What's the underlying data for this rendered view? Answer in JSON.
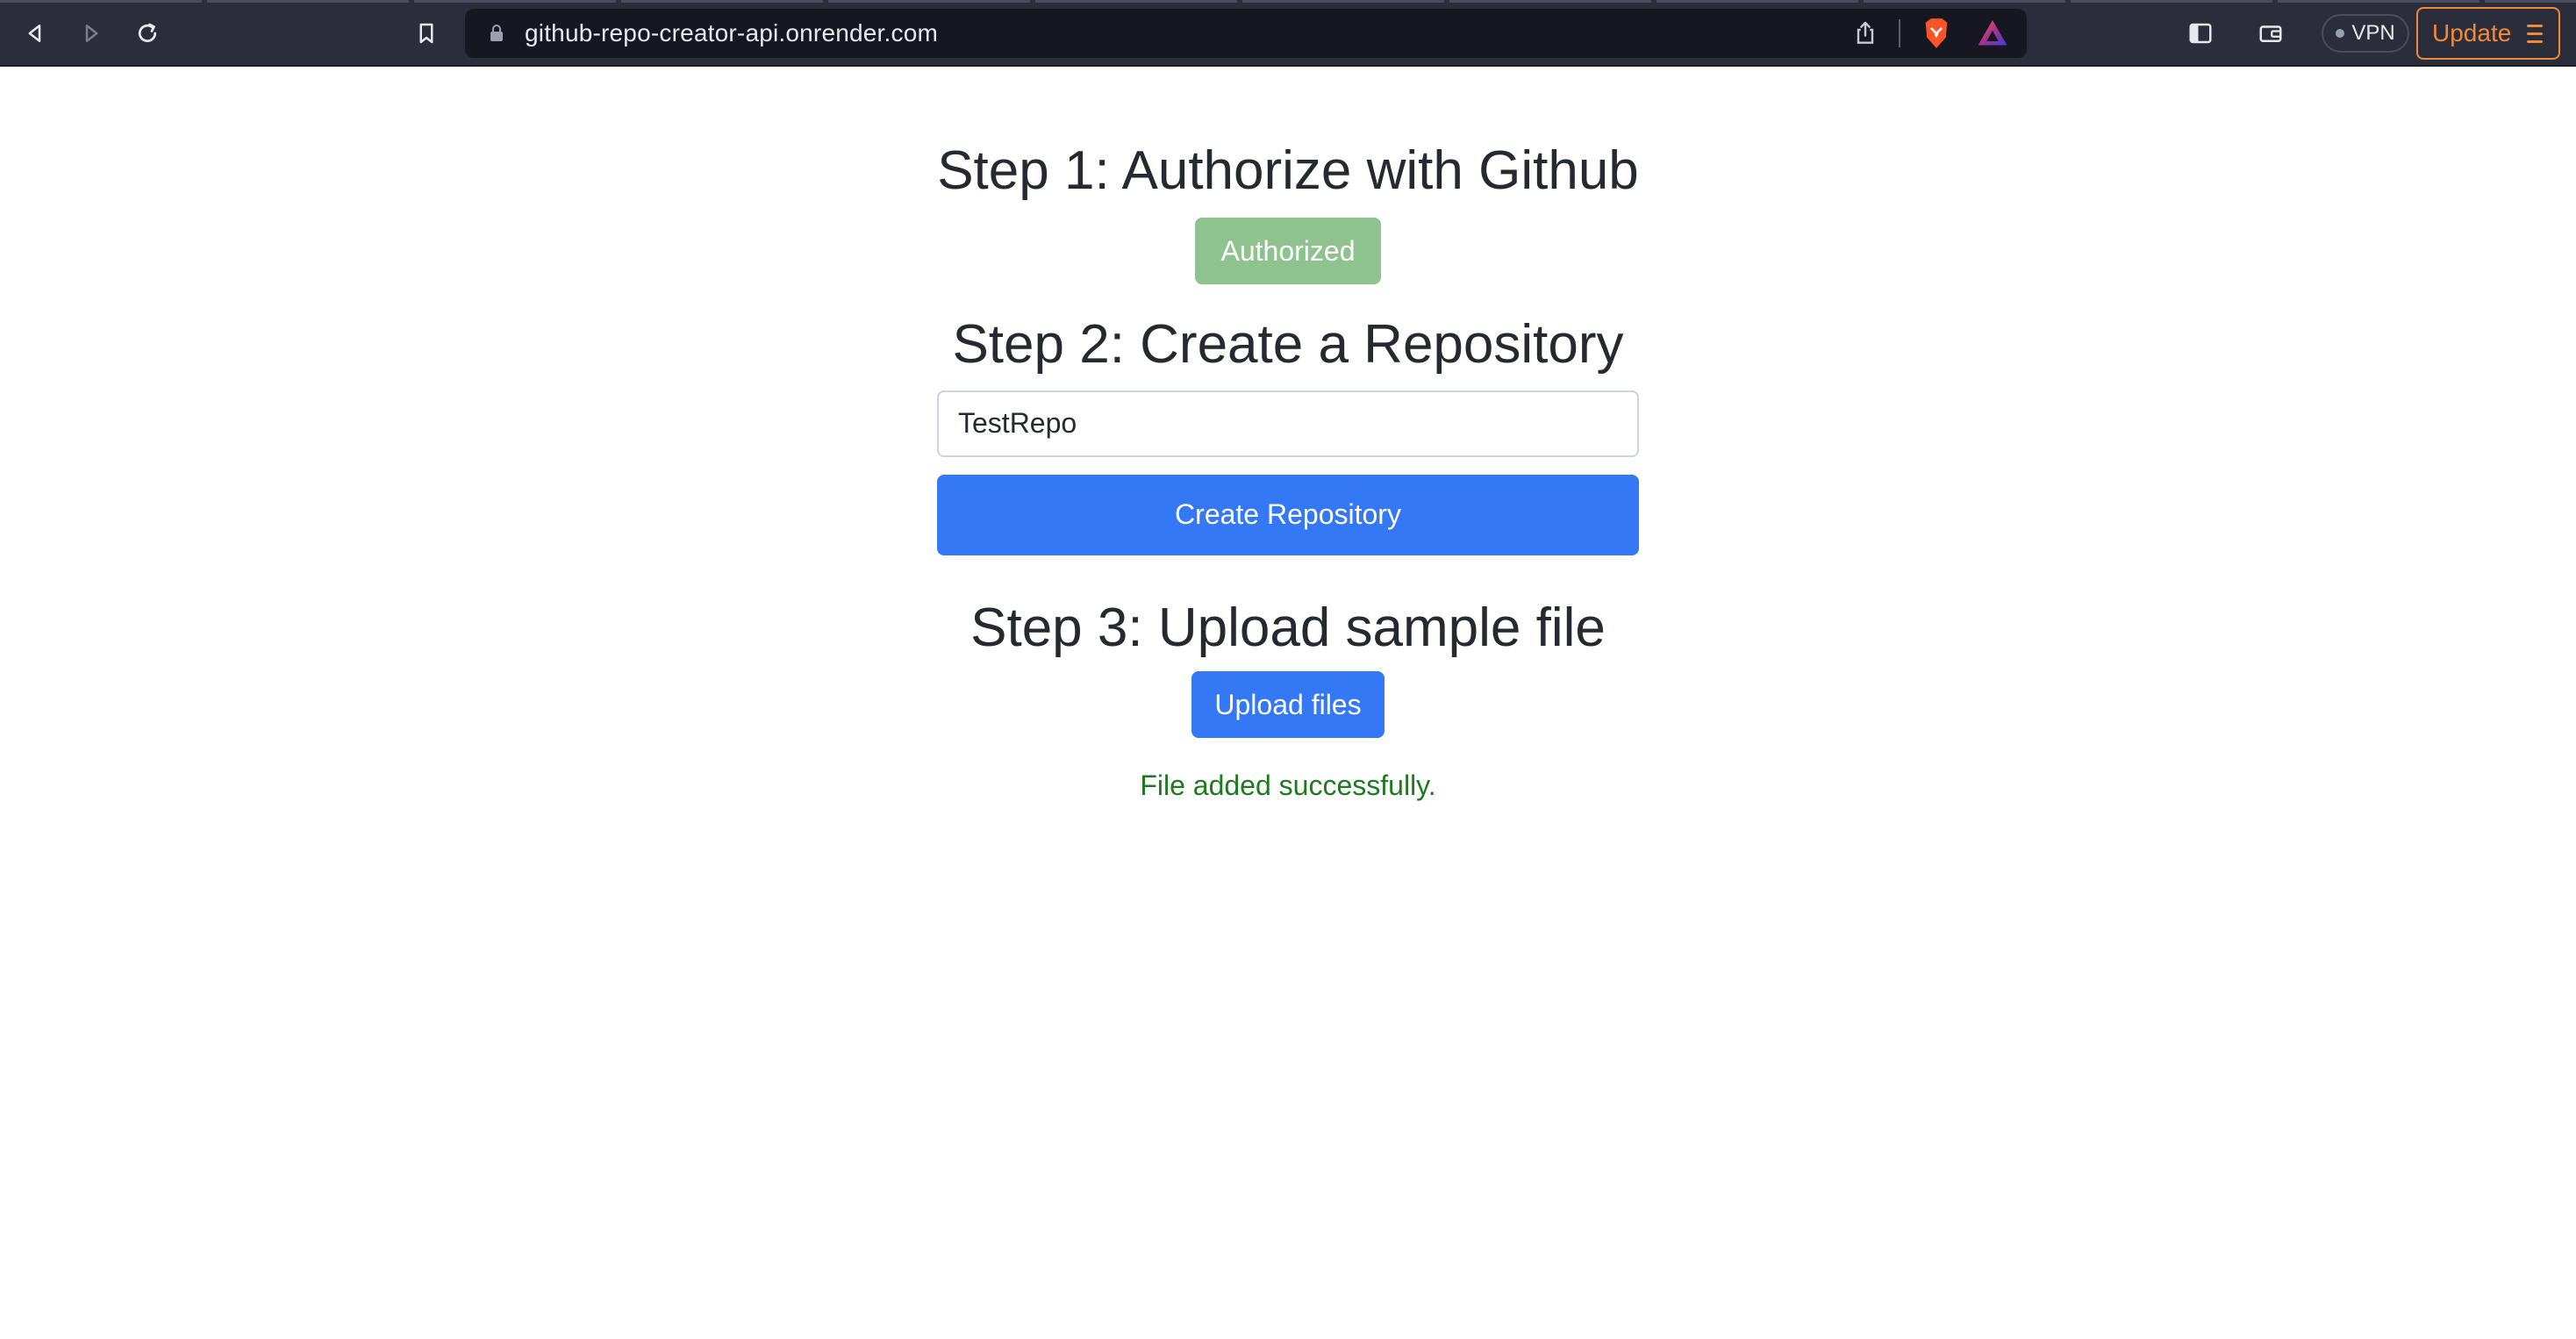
{
  "browser": {
    "url": "github-repo-creator-api.onrender.com",
    "vpn_label": "VPN",
    "update_label": "Update",
    "icons": [
      "back-icon",
      "forward-icon",
      "reload-icon",
      "bookmark-icon",
      "lock-icon",
      "share-icon",
      "brave-shields-icon",
      "brave-rewards-icon",
      "sidebar-icon",
      "wallet-icon",
      "menu-icon"
    ]
  },
  "steps": {
    "step1": {
      "title": "Step 1: Authorize with Github",
      "button_label": "Authorized"
    },
    "step2": {
      "title": "Step 2: Create a Repository",
      "input_value": "TestRepo",
      "button_label": "Create Repository"
    },
    "step3": {
      "title": "Step 3: Upload sample file",
      "button_label": "Upload files"
    }
  },
  "status_message": "File added successfully.",
  "colors": {
    "primary": "#3478f6",
    "authorized": "#8ec38f",
    "success_text": "#1e7a1e",
    "update_accent": "#f08a3b"
  }
}
